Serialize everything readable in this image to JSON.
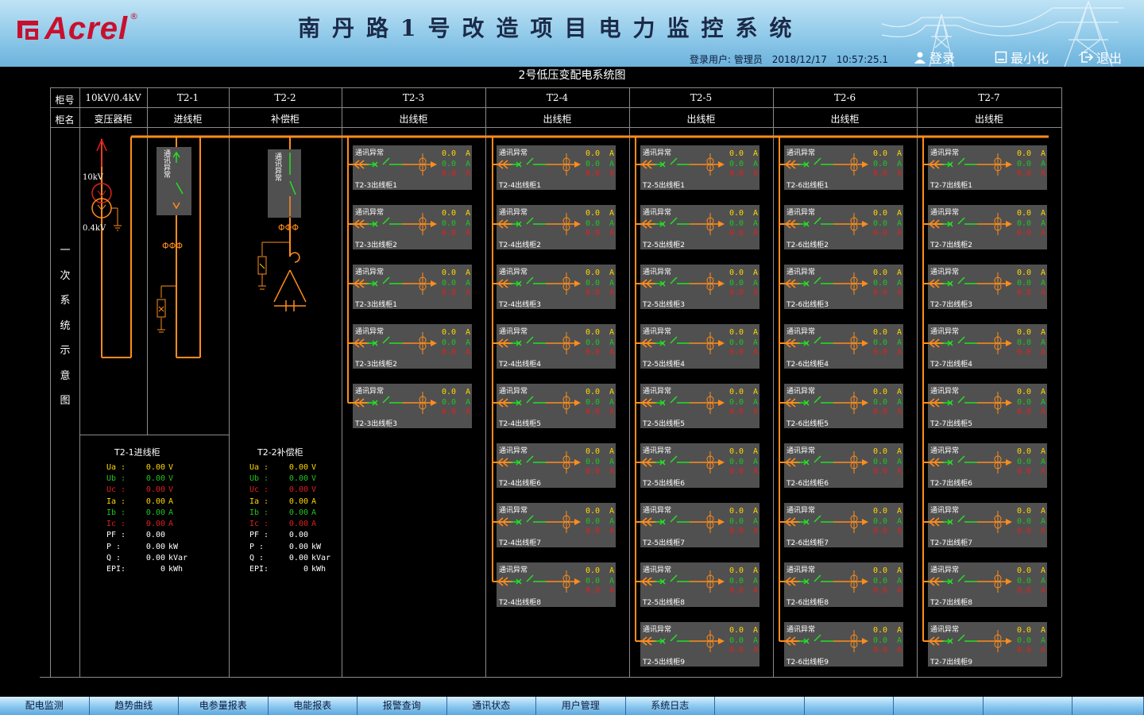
{
  "header": {
    "logo_text": "Acrel",
    "logo_reg": "®",
    "system_title": "南丹路1号改造项目电力监控系统",
    "login_user": "登录用户: 管理员",
    "date": "2018/12/17",
    "time": "10:57:25.1",
    "btn_login": "登录",
    "btn_minimize": "最小化",
    "btn_exit": "退出"
  },
  "diagram": {
    "title": "2号低压变配电系统图",
    "row1_label": "柜号",
    "row2_label": "柜名",
    "side_label": [
      "一",
      "次",
      "系",
      "统",
      "示",
      "意",
      "图"
    ],
    "cabinets": [
      {
        "id": "10kV/0.4kV",
        "name": "变压器柜"
      },
      {
        "id": "T2-1",
        "name": "进线柜"
      },
      {
        "id": "T2-2",
        "name": "补偿柜"
      },
      {
        "id": "T2-3",
        "name": "出线柜"
      },
      {
        "id": "T2-4",
        "name": "出线柜"
      },
      {
        "id": "T2-5",
        "name": "出线柜"
      },
      {
        "id": "T2-6",
        "name": "出线柜"
      },
      {
        "id": "T2-7",
        "name": "出线柜"
      }
    ],
    "transformer_hv": "10kV",
    "transformer_lv": "0.4kV",
    "incoming_status": "通讯异常",
    "comp_status": "通讯异常"
  },
  "feeders": {
    "status": "通讯异常",
    "unit": "A",
    "value": "0.0",
    "columns": [
      {
        "names": [
          "T2-3出线柜1",
          "T2-3出线柜2",
          "T2-3出线柜1",
          "T2-3出线柜2",
          "T2-3出线柜3"
        ]
      },
      {
        "names": [
          "T2-4出线柜1",
          "T2-4出线柜2",
          "T2-4出线柜3",
          "T2-4出线柜4",
          "T2-4出线柜5",
          "T2-4出线柜6",
          "T2-4出线柜7",
          "T2-4出线柜8"
        ]
      },
      {
        "names": [
          "T2-5出线柜1",
          "T2-5出线柜2",
          "T2-5出线柜3",
          "T2-5出线柜4",
          "T2-5出线柜5",
          "T2-5出线柜6",
          "T2-5出线柜7",
          "T2-5出线柜8",
          "T2-5出线柜9"
        ]
      },
      {
        "names": [
          "T2-6出线柜1",
          "T2-6出线柜2",
          "T2-6出线柜3",
          "T2-6出线柜4",
          "T2-6出线柜5",
          "T2-6出线柜6",
          "T2-6出线柜7",
          "T2-6出线柜8",
          "T2-6出线柜9"
        ]
      },
      {
        "names": [
          "T2-7出线柜1",
          "T2-7出线柜2",
          "T2-7出线柜3",
          "T2-7出线柜4",
          "T2-7出线柜5",
          "T2-7出线柜6",
          "T2-7出线柜7",
          "T2-7出线柜8",
          "T2-7出线柜9"
        ]
      }
    ]
  },
  "meters": [
    {
      "title": "T2-1进线柜",
      "rows": [
        {
          "label": "Ua :",
          "value": "0.00",
          "unit": "V",
          "color": "#ffd700"
        },
        {
          "label": "Ub :",
          "value": "0.00",
          "unit": "V",
          "color": "#22c322"
        },
        {
          "label": "Uc :",
          "value": "0.00",
          "unit": "V",
          "color": "#e02020"
        },
        {
          "label": "Ia :",
          "value": "0.00",
          "unit": "A",
          "color": "#ffd700"
        },
        {
          "label": "Ib :",
          "value": "0.00",
          "unit": "A",
          "color": "#22c322"
        },
        {
          "label": "Ic :",
          "value": "0.00",
          "unit": "A",
          "color": "#e02020"
        },
        {
          "label": "PF :",
          "value": "0.00",
          "unit": "",
          "color": "#ffffff"
        },
        {
          "label": "P  :",
          "value": "0.00",
          "unit": "kW",
          "color": "#ffffff"
        },
        {
          "label": "Q  :",
          "value": "0.00",
          "unit": "kVar",
          "color": "#ffffff"
        },
        {
          "label": "EPI:",
          "value": "0",
          "unit": "kWh",
          "color": "#ffffff"
        }
      ]
    },
    {
      "title": "T2-2补偿柜",
      "rows": [
        {
          "label": "Ua :",
          "value": "0.00",
          "unit": "V",
          "color": "#ffd700"
        },
        {
          "label": "Ub :",
          "value": "0.00",
          "unit": "V",
          "color": "#22c322"
        },
        {
          "label": "Uc :",
          "value": "0.00",
          "unit": "V",
          "color": "#e02020"
        },
        {
          "label": "Ia :",
          "value": "0.00",
          "unit": "A",
          "color": "#ffd700"
        },
        {
          "label": "Ib :",
          "value": "0.00",
          "unit": "A",
          "color": "#22c322"
        },
        {
          "label": "Ic :",
          "value": "0.00",
          "unit": "A",
          "color": "#e02020"
        },
        {
          "label": "PF :",
          "value": "0.00",
          "unit": "",
          "color": "#ffffff"
        },
        {
          "label": "P  :",
          "value": "0.00",
          "unit": "kW",
          "color": "#ffffff"
        },
        {
          "label": "Q  :",
          "value": "0.00",
          "unit": "kVar",
          "color": "#ffffff"
        },
        {
          "label": "EPI:",
          "value": "0",
          "unit": "kWh",
          "color": "#ffffff"
        }
      ]
    }
  ],
  "nav": [
    "配电监测",
    "趋势曲线",
    "电参量报表",
    "电能报表",
    "报警查询",
    "通讯状态",
    "用户管理",
    "系统日志",
    "",
    "",
    "",
    "",
    ""
  ],
  "colors": {
    "bus": "#ff8c1a",
    "phase_a": "#ffd700",
    "phase_b": "#22c322",
    "phase_c": "#e02020",
    "breaker": "#22e022",
    "panel": "#505050"
  }
}
